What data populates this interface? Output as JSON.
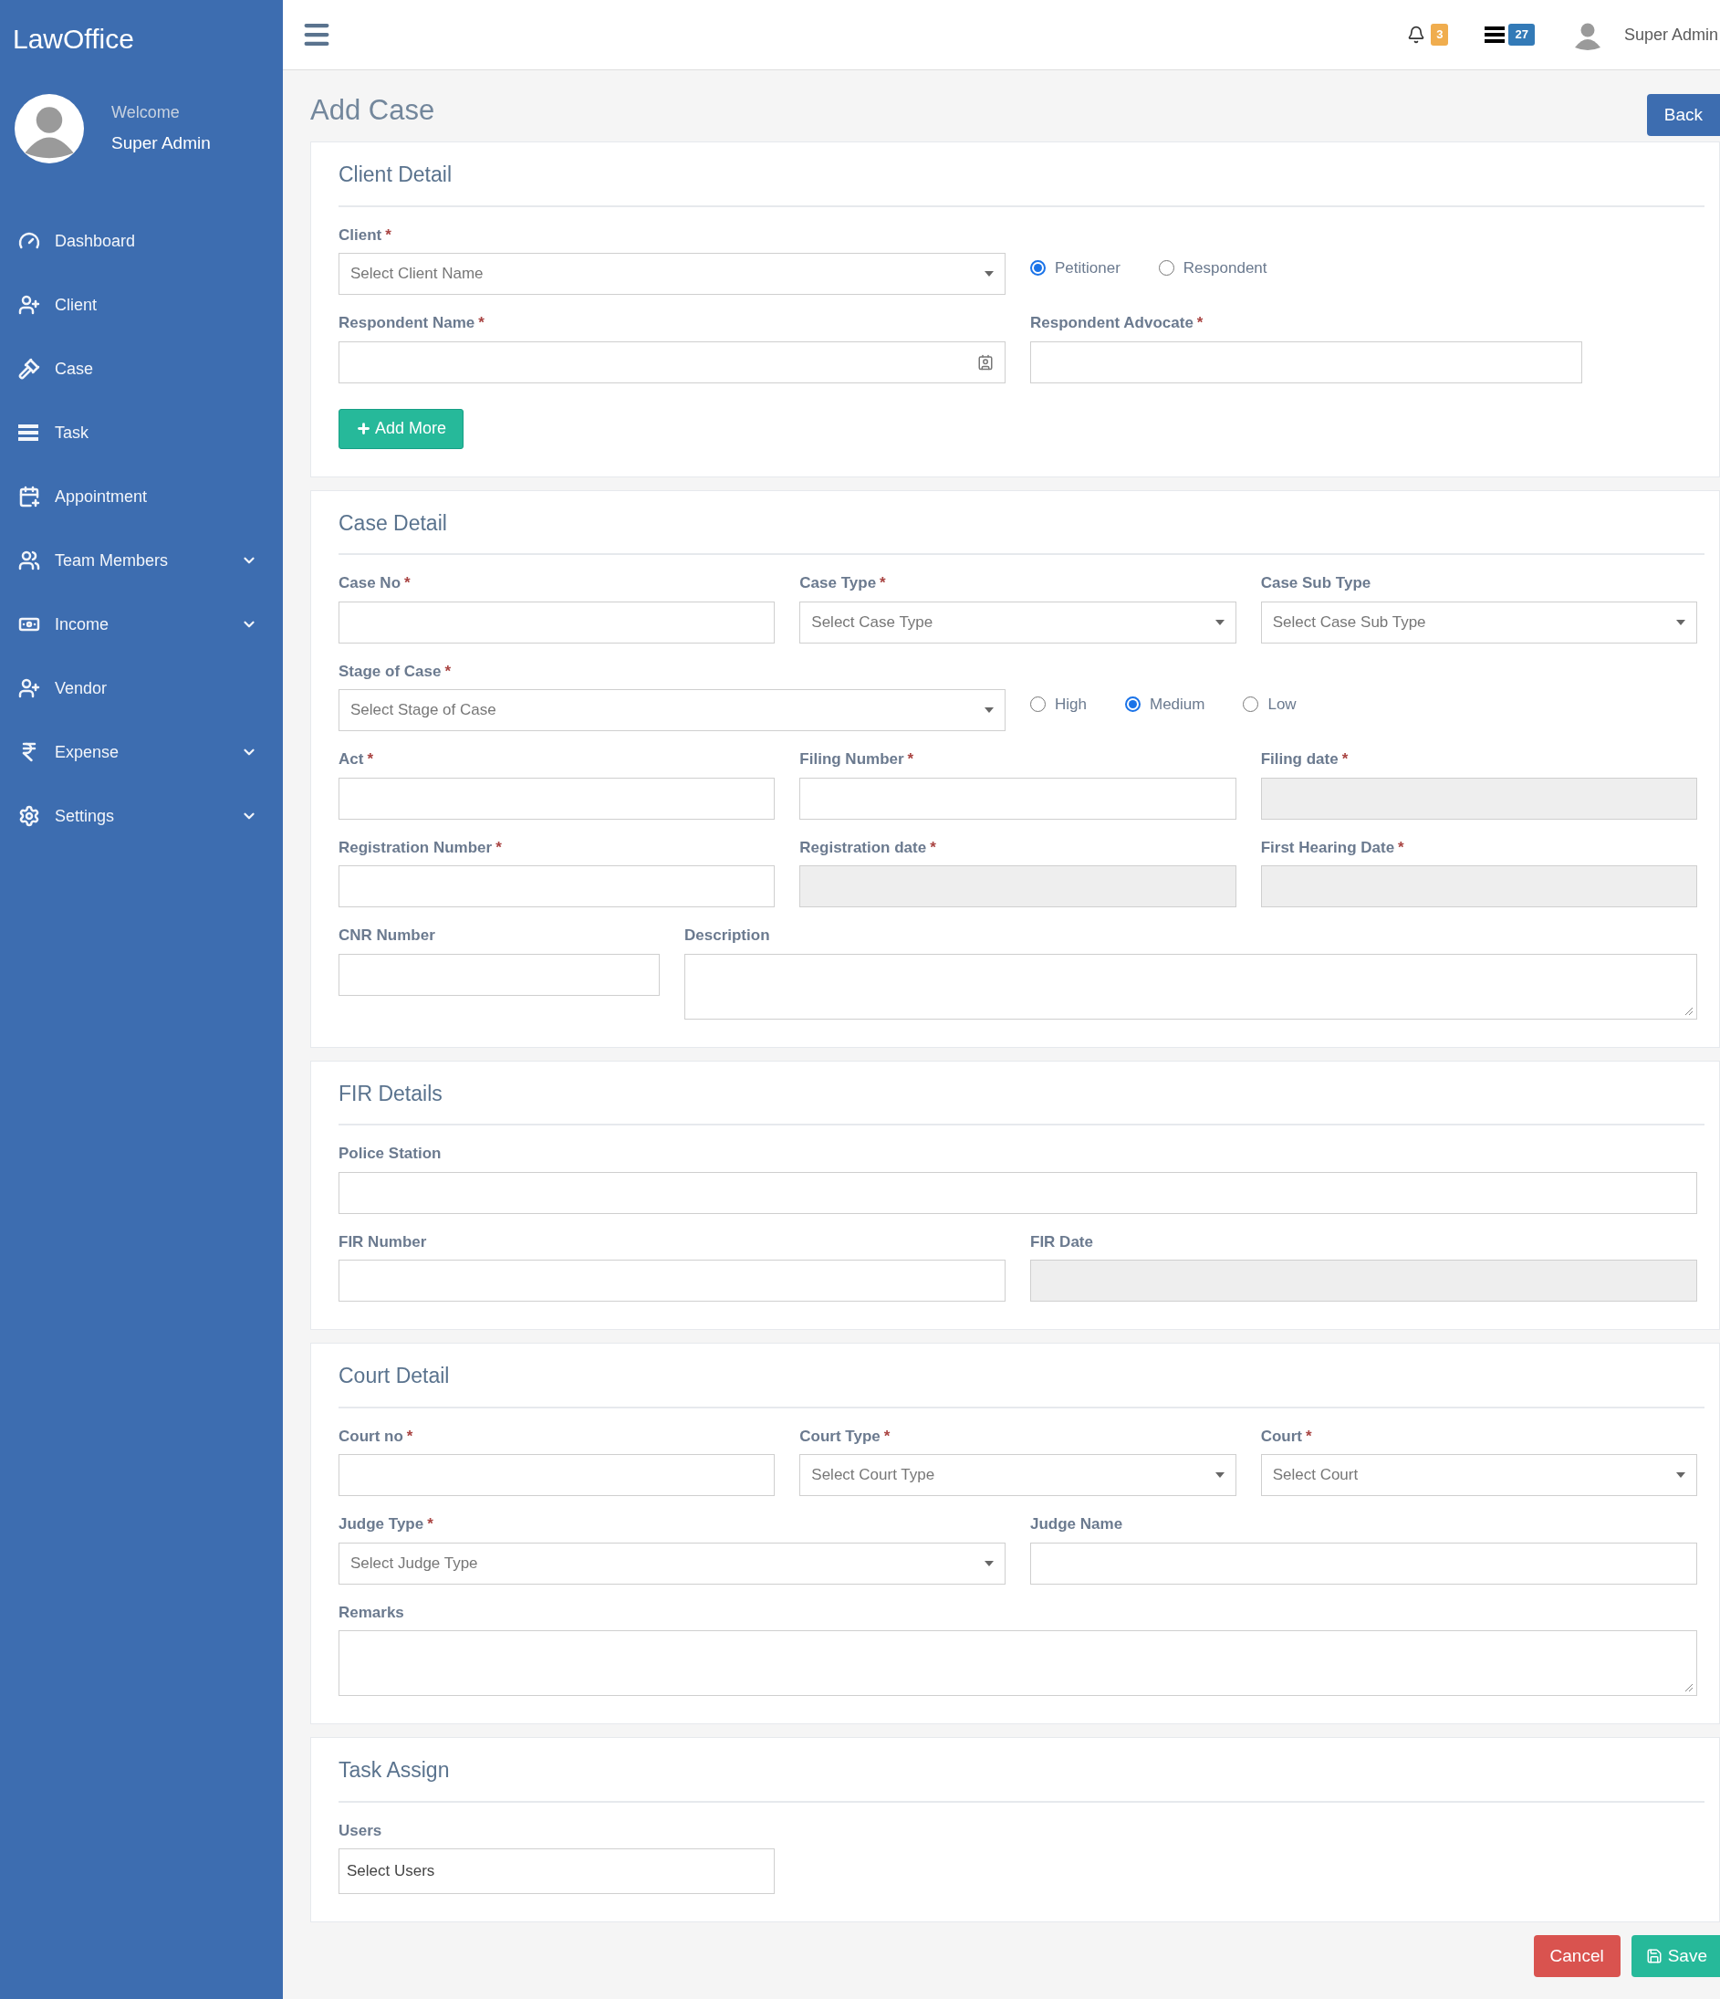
{
  "sidebar": {
    "brand": "LawOffice",
    "welcome": "Welcome",
    "user_name": "Super Admin",
    "items": [
      {
        "label": "Dashboard",
        "expandable": false
      },
      {
        "label": "Client",
        "expandable": false
      },
      {
        "label": "Case",
        "expandable": false
      },
      {
        "label": "Task",
        "expandable": false
      },
      {
        "label": "Appointment",
        "expandable": false
      },
      {
        "label": "Team Members",
        "expandable": true
      },
      {
        "label": "Income",
        "expandable": true
      },
      {
        "label": "Vendor",
        "expandable": false
      },
      {
        "label": "Expense",
        "expandable": true
      },
      {
        "label": "Settings",
        "expandable": true
      }
    ]
  },
  "header": {
    "notification_count": "3",
    "task_count": "27",
    "user_name": "Super Admin"
  },
  "page": {
    "title": "Add Case",
    "back_button": "Back"
  },
  "sections": [
    {
      "title": "Client Detail",
      "rows": [
        [
          {
            "kind": "select",
            "label": "Client",
            "mark": "*",
            "placeholder": "Select Client Name"
          },
          {
            "kind": "radio",
            "options": [
              {
                "label": "Petitioner",
                "selected": true
              },
              {
                "label": "Respondent",
                "selected": false
              }
            ]
          }
        ],
        [
          {
            "kind": "contact",
            "label": "Respondent Name",
            "mark": "*"
          },
          {
            "kind": "text",
            "label": "Respondent Advocate",
            "mark": "*"
          }
        ],
        [
          {
            "kind": "button",
            "label": "Add More"
          }
        ]
      ]
    },
    {
      "title": "Case Detail",
      "rows": [
        [
          {
            "kind": "text",
            "label": "Case No",
            "mark": "*"
          },
          {
            "kind": "select",
            "label": "Case Type",
            "mark": "*",
            "placeholder": "Select Case Type"
          },
          {
            "kind": "select",
            "label": "Case Sub Type",
            "placeholder": "Select Case Sub Type"
          }
        ],
        [
          {
            "kind": "select",
            "label": "Stage of Case",
            "mark": "*",
            "placeholder": "Select Stage of Case"
          },
          {
            "kind": "radio",
            "options": [
              {
                "label": "High",
                "selected": false
              },
              {
                "label": "Medium",
                "selected": true
              },
              {
                "label": "Low",
                "selected": false
              }
            ]
          }
        ],
        [
          {
            "kind": "text",
            "label": "Act",
            "mark": "*"
          },
          {
            "kind": "text",
            "label": "Filing Number",
            "mark": "*"
          },
          {
            "kind": "date",
            "label": "Filing date",
            "mark": "*"
          }
        ],
        [
          {
            "kind": "text",
            "label": "Registration Number",
            "mark": "*"
          },
          {
            "kind": "date",
            "label": "Registration date",
            "mark": "*"
          },
          {
            "kind": "date",
            "label": "First Hearing Date",
            "mark": "*"
          }
        ],
        [
          {
            "kind": "text",
            "label": "CNR Number"
          },
          {
            "kind": "textarea",
            "label": "Description"
          }
        ]
      ]
    },
    {
      "title": "FIR Details",
      "rows": [
        [
          {
            "kind": "text",
            "label": "Police Station"
          }
        ],
        [
          {
            "kind": "text",
            "label": "FIR Number"
          },
          {
            "kind": "date",
            "label": "FIR Date"
          }
        ]
      ]
    },
    {
      "title": "Court Detail",
      "rows": [
        [
          {
            "kind": "text",
            "label": "Court no",
            "mark": "*"
          },
          {
            "kind": "select",
            "label": "Court Type",
            "mark": "*",
            "placeholder": "Select Court Type"
          },
          {
            "kind": "select",
            "label": "Court",
            "mark": "*",
            "placeholder": "Select Court"
          }
        ],
        [
          {
            "kind": "select",
            "label": "Judge Type",
            "mark": "*",
            "placeholder": "Select Judge Type"
          },
          {
            "kind": "text",
            "label": "Judge Name"
          }
        ],
        [
          {
            "kind": "textarea",
            "label": "Remarks"
          }
        ]
      ]
    },
    {
      "title": "Task Assign",
      "rows": [
        [
          {
            "kind": "users",
            "label": "Users",
            "value": "Select Users"
          }
        ]
      ]
    }
  ],
  "actions": {
    "cancel": "Cancel",
    "save": "Save"
  }
}
